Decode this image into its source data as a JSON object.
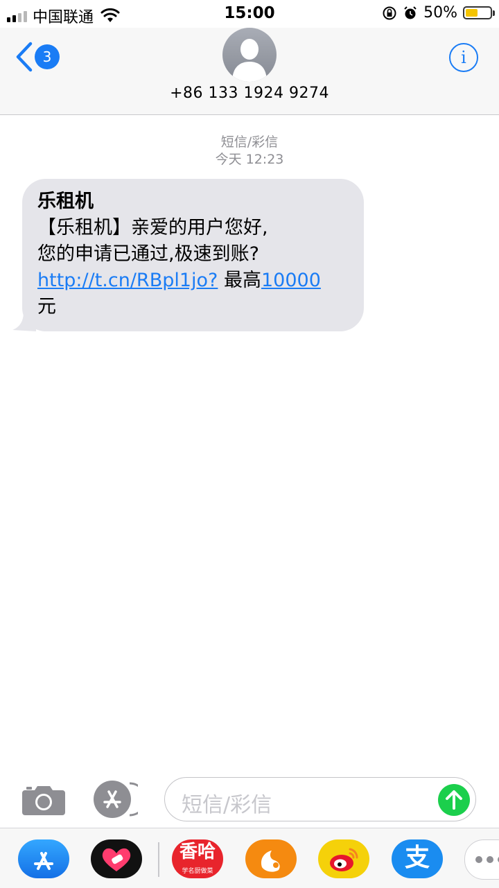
{
  "status_bar": {
    "carrier": "中国联通",
    "time": "15:00",
    "battery_percent": "50%",
    "battery_level": 0.5,
    "signal_bars": 2
  },
  "header": {
    "unread_count": "3",
    "contact_number": "+86 133 1924 9274"
  },
  "conversation": {
    "service_label": "短信/彩信",
    "timestamp": "今天 12:23",
    "message": {
      "sender": "乐租机",
      "line1": "【乐租机】亲爱的用户您好,",
      "line2": "您的申请已通过,极速到账?",
      "link": "http://t.cn/RBpl1jo?",
      "mid": " 最高",
      "amount": "10000",
      "tail": "元"
    }
  },
  "composer": {
    "placeholder": "短信/彩信"
  },
  "app_drawer": {
    "apps": [
      {
        "icon": "app-store-icon"
      },
      {
        "icon": "health-icon"
      },
      {
        "icon": "xianghe-icon",
        "label": "香哈",
        "sublabel": "学名厨做菜"
      },
      {
        "icon": "uc-browser-icon"
      },
      {
        "icon": "weibo-icon"
      },
      {
        "icon": "alipay-icon",
        "label": "支"
      },
      {
        "icon": "more-icon"
      }
    ]
  },
  "colors": {
    "accent": "#1a7cf5",
    "bubble": "#e5e5ea",
    "send": "#1bcf4c"
  }
}
